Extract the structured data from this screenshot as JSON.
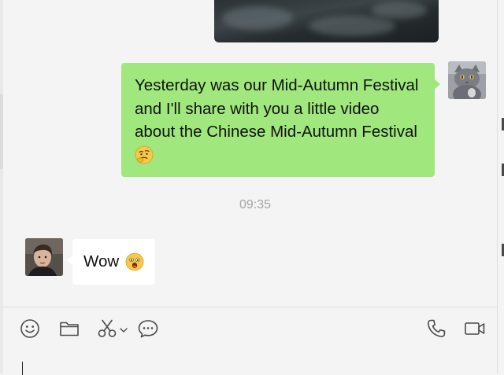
{
  "messages": [
    {
      "sender": "me",
      "text": "Yesterday was our Mid-Autumn Festival and I'll share with you a little video about the Chinese Mid-Autumn Festival",
      "trailing_emoji": "thinking-face-emoji"
    },
    {
      "sender": "contact",
      "text": "Wow",
      "trailing_emoji": "astonished-face-emoji"
    }
  ],
  "timestamp": "09:35",
  "toolbar": {
    "left_icons": [
      "emoji-icon",
      "folder-icon",
      "scissors-icon",
      "chevron-down-icon",
      "chat-bubble-icon"
    ],
    "right_icons": [
      "phone-icon",
      "video-call-icon"
    ]
  },
  "colors": {
    "my_bubble": "#a0e77d",
    "their_bubble": "#ffffff",
    "background": "#f4f4f4",
    "timestamp": "#a4a4a4"
  }
}
